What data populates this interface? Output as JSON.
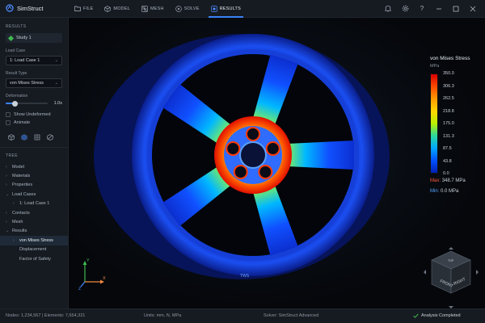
{
  "app": {
    "title": "SimStruct"
  },
  "menu": [
    {
      "label": "FILE",
      "icon": "folder-icon"
    },
    {
      "label": "MODEL",
      "icon": "cube-outline-icon"
    },
    {
      "label": "MESH",
      "icon": "mesh-icon"
    },
    {
      "label": "SOLVE",
      "icon": "play-circle-icon"
    },
    {
      "label": "RESULTS",
      "icon": "results-icon",
      "active": true
    }
  ],
  "window_controls": [
    "bell-icon",
    "gear-icon",
    "help-icon",
    "minimize-icon",
    "maximize-icon",
    "close-icon"
  ],
  "sidebar": {
    "section_title": "RESULTS",
    "study": "Study 1",
    "load_case_label": "Load Case",
    "load_case_value": "1: Load Case 1",
    "result_type_label": "Result Type",
    "result_type_value": "von Mises Stress",
    "deformation_label": "Deformation",
    "deformation_value": "1.0x",
    "deformation_fraction": 0.22,
    "show_undeformed": "Show Undeformed",
    "animate": "Animate",
    "tools": [
      "iso-view-icon",
      "front-view-icon",
      "probe-icon",
      "section-icon"
    ],
    "tree_title": "TREE",
    "tree": [
      {
        "label": "Model",
        "level": 0,
        "arrow": "›"
      },
      {
        "label": "Materials",
        "level": 0,
        "arrow": "›"
      },
      {
        "label": "Properties",
        "level": 0,
        "arrow": "›"
      },
      {
        "label": "Load Cases",
        "level": 0,
        "arrow": "⌄"
      },
      {
        "label": "1: Load Case 1",
        "level": 1,
        "arrow": "›"
      },
      {
        "label": "Contacts",
        "level": 0,
        "arrow": "›"
      },
      {
        "label": "Mesh",
        "level": 0,
        "arrow": "›"
      },
      {
        "label": "Results",
        "level": 0,
        "arrow": "⌄"
      },
      {
        "label": "von Mises Stress",
        "level": 1,
        "arrow": "›",
        "selected": true
      },
      {
        "label": "Displacement",
        "level": 1,
        "arrow": ""
      },
      {
        "label": "Factor of Safety",
        "level": 1,
        "arrow": ""
      }
    ]
  },
  "legend": {
    "title": "von Mises Stress",
    "unit": "MPa",
    "ticks": [
      "350.0",
      "306.3",
      "262.5",
      "218.8",
      "175.0",
      "131.3",
      "87.5",
      "43.8",
      "0.0"
    ],
    "max_key": "Max:",
    "max_value": "348.7 MPa",
    "min_key": "Min:",
    "min_value": "0.0 MPa"
  },
  "view_cube": {
    "front": "FRONT",
    "right": "RIGHT",
    "top": "TOP"
  },
  "axes": {
    "x": "X",
    "y": "Y",
    "z": "Z"
  },
  "wheel": {
    "rim_text": "TWS"
  },
  "status": {
    "nodes": "Nodes: 1,234,567  |  Elements: 7,654,321",
    "units": "Units: mm, N, MPa",
    "solver": "Solver: SimStruct Advanced",
    "state": "Analysis Completed"
  },
  "colors": {
    "accent": "#3b82f6",
    "success": "#3fb950",
    "max": "#ff5a3c",
    "min": "#58a6ff"
  }
}
